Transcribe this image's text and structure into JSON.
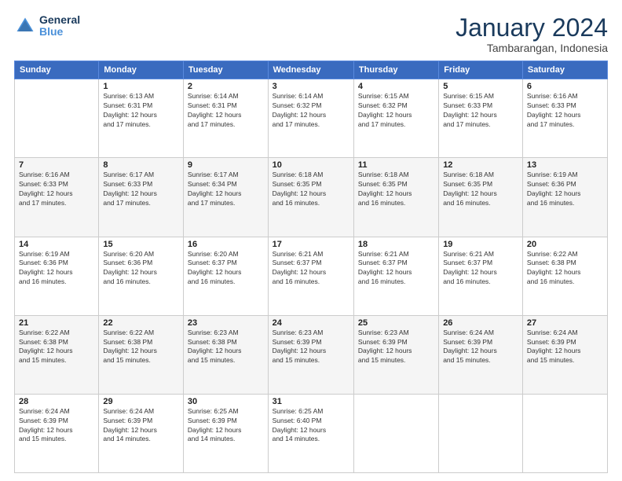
{
  "logo": {
    "text_general": "General",
    "text_blue": "Blue"
  },
  "header": {
    "title": "January 2024",
    "subtitle": "Tambarangan, Indonesia"
  },
  "columns": [
    "Sunday",
    "Monday",
    "Tuesday",
    "Wednesday",
    "Thursday",
    "Friday",
    "Saturday"
  ],
  "weeks": [
    [
      {
        "day": "",
        "sunrise": "",
        "sunset": "",
        "daylight": ""
      },
      {
        "day": "1",
        "sunrise": "Sunrise: 6:13 AM",
        "sunset": "Sunset: 6:31 PM",
        "daylight": "Daylight: 12 hours and 17 minutes."
      },
      {
        "day": "2",
        "sunrise": "Sunrise: 6:14 AM",
        "sunset": "Sunset: 6:31 PM",
        "daylight": "Daylight: 12 hours and 17 minutes."
      },
      {
        "day": "3",
        "sunrise": "Sunrise: 6:14 AM",
        "sunset": "Sunset: 6:32 PM",
        "daylight": "Daylight: 12 hours and 17 minutes."
      },
      {
        "day": "4",
        "sunrise": "Sunrise: 6:15 AM",
        "sunset": "Sunset: 6:32 PM",
        "daylight": "Daylight: 12 hours and 17 minutes."
      },
      {
        "day": "5",
        "sunrise": "Sunrise: 6:15 AM",
        "sunset": "Sunset: 6:33 PM",
        "daylight": "Daylight: 12 hours and 17 minutes."
      },
      {
        "day": "6",
        "sunrise": "Sunrise: 6:16 AM",
        "sunset": "Sunset: 6:33 PM",
        "daylight": "Daylight: 12 hours and 17 minutes."
      }
    ],
    [
      {
        "day": "7",
        "sunrise": "Sunrise: 6:16 AM",
        "sunset": "Sunset: 6:33 PM",
        "daylight": "Daylight: 12 hours and 17 minutes."
      },
      {
        "day": "8",
        "sunrise": "Sunrise: 6:17 AM",
        "sunset": "Sunset: 6:33 PM",
        "daylight": "Daylight: 12 hours and 17 minutes."
      },
      {
        "day": "9",
        "sunrise": "Sunrise: 6:17 AM",
        "sunset": "Sunset: 6:34 PM",
        "daylight": "Daylight: 12 hours and 17 minutes."
      },
      {
        "day": "10",
        "sunrise": "Sunrise: 6:18 AM",
        "sunset": "Sunset: 6:35 PM",
        "daylight": "Daylight: 12 hours and 16 minutes."
      },
      {
        "day": "11",
        "sunrise": "Sunrise: 6:18 AM",
        "sunset": "Sunset: 6:35 PM",
        "daylight": "Daylight: 12 hours and 16 minutes."
      },
      {
        "day": "12",
        "sunrise": "Sunrise: 6:18 AM",
        "sunset": "Sunset: 6:35 PM",
        "daylight": "Daylight: 12 hours and 16 minutes."
      },
      {
        "day": "13",
        "sunrise": "Sunrise: 6:19 AM",
        "sunset": "Sunset: 6:36 PM",
        "daylight": "Daylight: 12 hours and 16 minutes."
      }
    ],
    [
      {
        "day": "14",
        "sunrise": "Sunrise: 6:19 AM",
        "sunset": "Sunset: 6:36 PM",
        "daylight": "Daylight: 12 hours and 16 minutes."
      },
      {
        "day": "15",
        "sunrise": "Sunrise: 6:20 AM",
        "sunset": "Sunset: 6:36 PM",
        "daylight": "Daylight: 12 hours and 16 minutes."
      },
      {
        "day": "16",
        "sunrise": "Sunrise: 6:20 AM",
        "sunset": "Sunset: 6:37 PM",
        "daylight": "Daylight: 12 hours and 16 minutes."
      },
      {
        "day": "17",
        "sunrise": "Sunrise: 6:21 AM",
        "sunset": "Sunset: 6:37 PM",
        "daylight": "Daylight: 12 hours and 16 minutes."
      },
      {
        "day": "18",
        "sunrise": "Sunrise: 6:21 AM",
        "sunset": "Sunset: 6:37 PM",
        "daylight": "Daylight: 12 hours and 16 minutes."
      },
      {
        "day": "19",
        "sunrise": "Sunrise: 6:21 AM",
        "sunset": "Sunset: 6:37 PM",
        "daylight": "Daylight: 12 hours and 16 minutes."
      },
      {
        "day": "20",
        "sunrise": "Sunrise: 6:22 AM",
        "sunset": "Sunset: 6:38 PM",
        "daylight": "Daylight: 12 hours and 16 minutes."
      }
    ],
    [
      {
        "day": "21",
        "sunrise": "Sunrise: 6:22 AM",
        "sunset": "Sunset: 6:38 PM",
        "daylight": "Daylight: 12 hours and 15 minutes."
      },
      {
        "day": "22",
        "sunrise": "Sunrise: 6:22 AM",
        "sunset": "Sunset: 6:38 PM",
        "daylight": "Daylight: 12 hours and 15 minutes."
      },
      {
        "day": "23",
        "sunrise": "Sunrise: 6:23 AM",
        "sunset": "Sunset: 6:38 PM",
        "daylight": "Daylight: 12 hours and 15 minutes."
      },
      {
        "day": "24",
        "sunrise": "Sunrise: 6:23 AM",
        "sunset": "Sunset: 6:39 PM",
        "daylight": "Daylight: 12 hours and 15 minutes."
      },
      {
        "day": "25",
        "sunrise": "Sunrise: 6:23 AM",
        "sunset": "Sunset: 6:39 PM",
        "daylight": "Daylight: 12 hours and 15 minutes."
      },
      {
        "day": "26",
        "sunrise": "Sunrise: 6:24 AM",
        "sunset": "Sunset: 6:39 PM",
        "daylight": "Daylight: 12 hours and 15 minutes."
      },
      {
        "day": "27",
        "sunrise": "Sunrise: 6:24 AM",
        "sunset": "Sunset: 6:39 PM",
        "daylight": "Daylight: 12 hours and 15 minutes."
      }
    ],
    [
      {
        "day": "28",
        "sunrise": "Sunrise: 6:24 AM",
        "sunset": "Sunset: 6:39 PM",
        "daylight": "Daylight: 12 hours and 15 minutes."
      },
      {
        "day": "29",
        "sunrise": "Sunrise: 6:24 AM",
        "sunset": "Sunset: 6:39 PM",
        "daylight": "Daylight: 12 hours and 14 minutes."
      },
      {
        "day": "30",
        "sunrise": "Sunrise: 6:25 AM",
        "sunset": "Sunset: 6:39 PM",
        "daylight": "Daylight: 12 hours and 14 minutes."
      },
      {
        "day": "31",
        "sunrise": "Sunrise: 6:25 AM",
        "sunset": "Sunset: 6:40 PM",
        "daylight": "Daylight: 12 hours and 14 minutes."
      },
      {
        "day": "",
        "sunrise": "",
        "sunset": "",
        "daylight": ""
      },
      {
        "day": "",
        "sunrise": "",
        "sunset": "",
        "daylight": ""
      },
      {
        "day": "",
        "sunrise": "",
        "sunset": "",
        "daylight": ""
      }
    ]
  ]
}
